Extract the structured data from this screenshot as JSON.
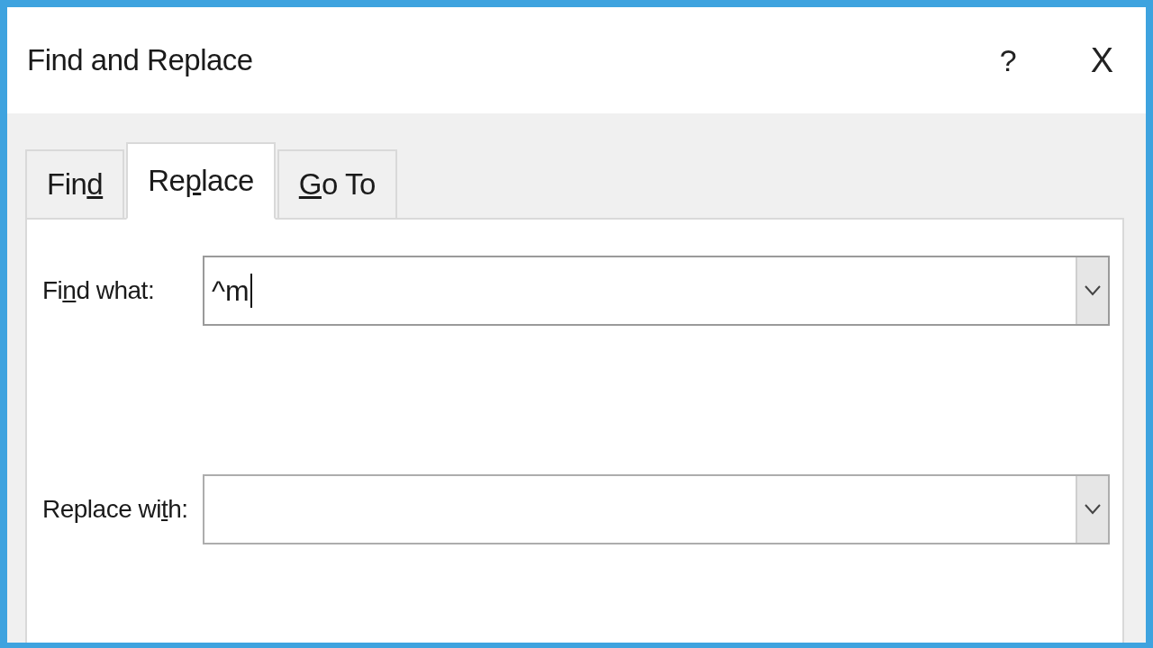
{
  "window": {
    "title": "Find and Replace",
    "buttons": [
      {
        "kind": "help",
        "label": "?"
      },
      {
        "kind": "close",
        "label": "X"
      }
    ]
  },
  "tabs": [
    {
      "before": "Fin",
      "key": "d",
      "selected": false
    },
    {
      "before": "Re",
      "key": "p",
      "after": "lace",
      "selected": true
    },
    {
      "key": "G",
      "after": "o To",
      "selected": false
    }
  ],
  "fields": [
    {
      "before": "Fi",
      "key": "n",
      "after": "d what:",
      "value": "^m",
      "focused": true
    },
    {
      "before": "Replace wi",
      "key": "t",
      "after": "h:",
      "focused": false
    }
  ]
}
